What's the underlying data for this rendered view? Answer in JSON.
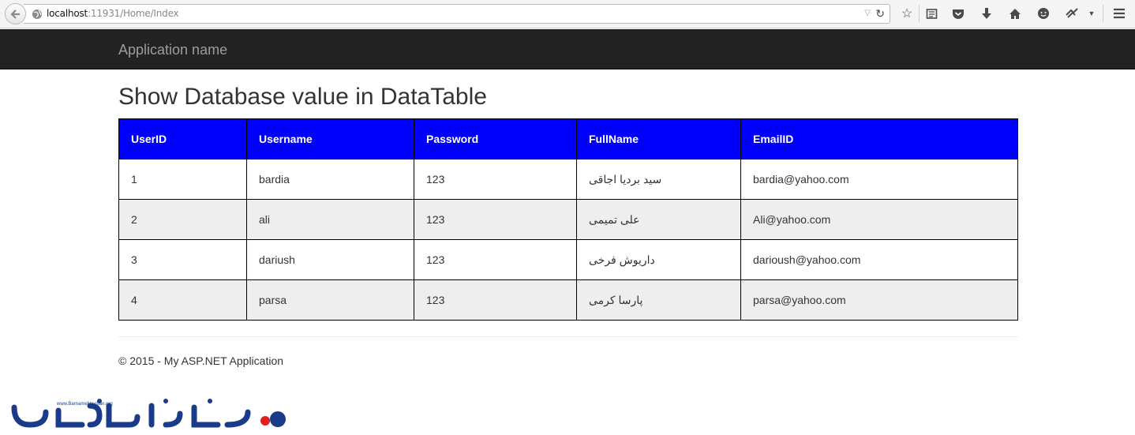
{
  "browser": {
    "url_host": "localhost",
    "url_rest": ":11931/Home/Index",
    "icons": [
      "back-icon",
      "globe-icon",
      "dropdown-icon",
      "reload-icon",
      "bookmark-star-icon",
      "reading-list-icon",
      "pocket-icon",
      "download-icon",
      "home-icon",
      "chat-icon",
      "extension-icon",
      "menu-chevron-icon",
      "hamburger-menu-icon"
    ]
  },
  "navbar": {
    "brand": "Application name"
  },
  "page": {
    "title": "Show Database value in DataTable"
  },
  "table": {
    "headers": [
      "UserID",
      "Username",
      "Password",
      "FullName",
      "EmailID"
    ],
    "rows": [
      [
        "1",
        "bardia",
        "123",
        "سید بردیا اجاقی",
        "bardia@yahoo.com"
      ],
      [
        "2",
        "ali",
        "123",
        "علی تمیمی",
        "Ali@yahoo.com"
      ],
      [
        "3",
        "dariush",
        "123",
        "داریوش فرخی",
        "darioush@yahoo.com"
      ],
      [
        "4",
        "parsa",
        "123",
        "پارسا کرمی",
        "parsa@yahoo.com"
      ]
    ],
    "header_color": "#0000ff",
    "alt_row_color": "#eeeeee"
  },
  "footer": {
    "text": "© 2015 - My ASP.NET Application"
  },
  "watermark": {
    "site": "www.BarnameNevisan.org",
    "logo_text": "برنامه نویسان",
    "color": "#1a3a8a"
  }
}
